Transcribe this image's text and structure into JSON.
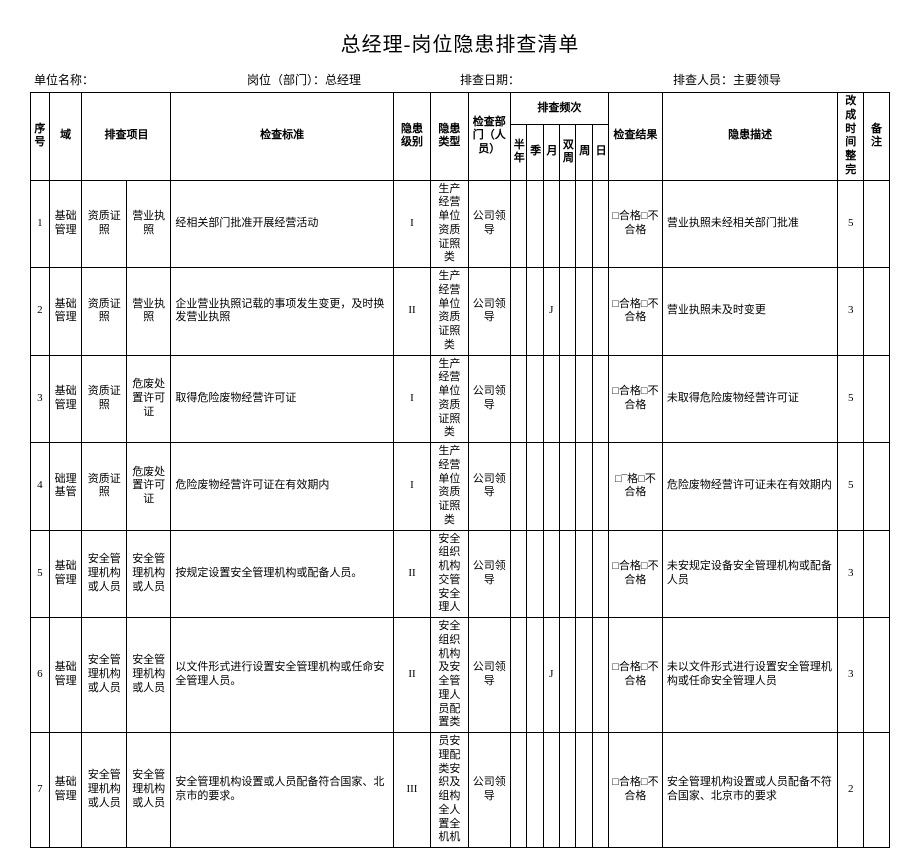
{
  "title": "总经理-岗位隐患排查清单",
  "meta": {
    "unit_label": "单位名称：",
    "post_label": "岗位（部门）：总经理",
    "date_label": "排查日期：",
    "person_label": "排查人员：主要领导"
  },
  "headers": {
    "seq": "序号",
    "category": "域",
    "item": "排查项目",
    "standard": "检查标准",
    "level": "隐患级别",
    "type": "隐患类型",
    "dept": "检查部门（人员）",
    "freq": "排查频次",
    "freq_cols": [
      "半年",
      "季",
      "月",
      "双周",
      "周",
      "日"
    ],
    "result": "检查结果",
    "desc": "隐患描述",
    "days": "改成时间整完",
    "note": "备注"
  },
  "rows": [
    {
      "seq": "1",
      "cat": "基础管理",
      "item1": "资质证照",
      "item2": "营业执照",
      "std": "经相关部门批准开展经营活动",
      "level": "I",
      "type": "生产经营单位资质证照类",
      "dept": "公司领导",
      "freq": [
        "",
        "",
        "",
        "",
        "",
        ""
      ],
      "result": "□合格□不合格",
      "desc": "营业执照未经相关部门批准",
      "days": "5",
      "note": ""
    },
    {
      "seq": "2",
      "cat": "基础管理",
      "item1": "资质证照",
      "item2": "营业执照",
      "std": "企业营业执照记载的事项发生变更，及时换发营业执照",
      "level": "II",
      "type": "生产经营单位资质证照类",
      "dept": "公司领导",
      "freq": [
        "",
        "",
        "J",
        "",
        "",
        ""
      ],
      "result": "□合格□不合格",
      "desc": "营业执照未及时变更",
      "days": "3",
      "note": ""
    },
    {
      "seq": "3",
      "cat": "基础管理",
      "item1": "资质证照",
      "item2": "危废处置许可证",
      "std": "取得危险废物经营许可证",
      "level": "I",
      "type": "生产经营单位资质证照类",
      "dept": "公司领导",
      "freq": [
        "",
        "",
        "",
        "",
        "",
        ""
      ],
      "result": "□合格□不合格",
      "desc": "未取得危险废物经营许可证",
      "days": "5",
      "note": ""
    },
    {
      "seq": "4",
      "cat": "础理基管",
      "item1": "资质证照",
      "item2": "危废处置许可证",
      "std": "危险废物经营许可证在有效期内",
      "level": "I",
      "type": "生产经营单位资质证照类",
      "dept": "公司领导",
      "freq": [
        "",
        "",
        "",
        "",
        "",
        ""
      ],
      "result": "□¯格□不合格",
      "desc": "危险废物经营许可证未在有效期内",
      "days": "5",
      "note": ""
    },
    {
      "seq": "5",
      "cat": "基础管理",
      "item1": "安全管理机构或人员",
      "item2": "安全管理机构或人员",
      "std": "按规定设置安全管理机构或配备人员。",
      "level": "II",
      "type": "安全组织机构交管安全理人",
      "dept": "公司领导",
      "freq": [
        "",
        "",
        "",
        "",
        "",
        ""
      ],
      "result": "□合格□不合格",
      "desc": "未安规定设备安全管理机构或配备人员",
      "days": "3",
      "note": ""
    },
    {
      "seq": "6",
      "cat": "基础管理",
      "item1": "安全管理机构或人员",
      "item2": "安全管理机构或人员",
      "std": "以文件形式进行设置安全管理机构或任命安全管理人员。",
      "level": "II",
      "type": "安全组织机构及安全管理人员配置类",
      "dept": "公司领导",
      "freq": [
        "",
        "",
        "J",
        "",
        "",
        ""
      ],
      "result": "□合格□不合格",
      "desc": "未以文件形式进行设置安全管理机构或任命安全管理人员",
      "days": "3",
      "note": ""
    },
    {
      "seq": "7",
      "cat": "基础管理",
      "item1": "安全管理机构或人员",
      "item2": "安全管理机构或人员",
      "std": "安全管理机构设置或人员配备符合国家、北京市的要求。",
      "level": "III",
      "type": "员安理配类安织及组构全人置全机机",
      "dept": "公司领导",
      "freq": [
        "",
        "",
        "",
        "",
        "",
        ""
      ],
      "result": "□合格□不合格",
      "desc": "安全管理机构设置或人员配备不符合国家、北京市的要求",
      "days": "2",
      "note": ""
    }
  ]
}
